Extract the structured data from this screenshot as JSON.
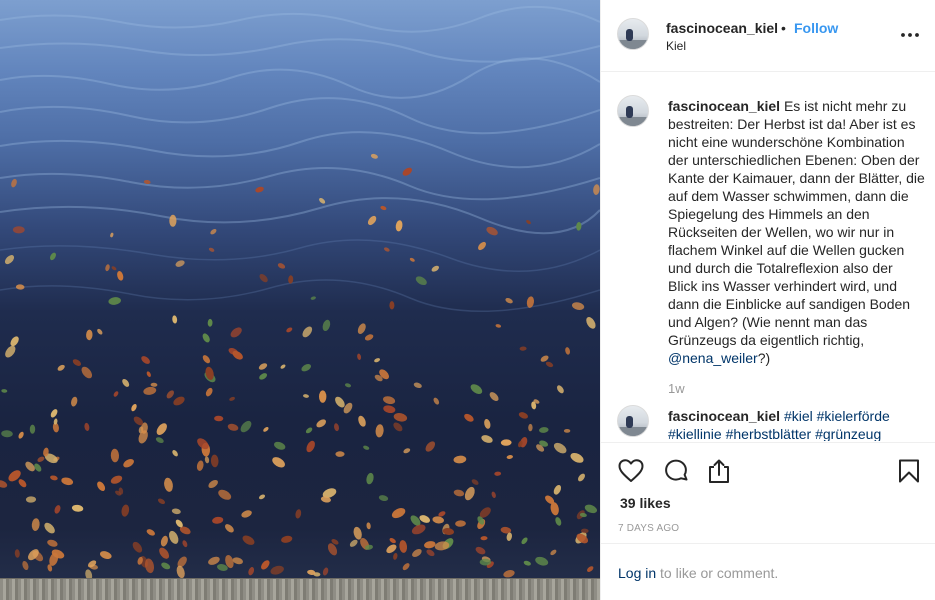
{
  "post": {
    "username": "fascinocean_kiel",
    "separator": "•",
    "follow_label": "Follow",
    "location": "Kiel",
    "caption": {
      "username": "fascinocean_kiel",
      "text": "Es ist nicht mehr zu bestreiten: Der Herbst ist da! Aber ist es nicht eine wunderschöne Kombination der unterschiedlichen Ebenen: Oben der Kante der Kaimauer, dann der Blätter, die auf dem Wasser schwimmen, dann die Spiegelung des Himmels an den Rückseiten der Wellen, wo wir nur in flachem Winkel auf die Wellen gucken und durch die Totalreflexion also der Blick ins Wasser verhindert wird, und dann die Einblicke auf sandigen Boden und Algen? (Wie nennt man das Grünzeugs da eigentlich richtig, ",
      "mention": "@nena_weiler",
      "suffix": "?)",
      "age": "1w"
    },
    "comment": {
      "username": "fascinocean_kiel",
      "hashtags": [
        "#kiel",
        "#kielerförde",
        "#kiellinie",
        "#herbstblätter",
        "#grünzeug"
      ]
    },
    "likes": "39 likes",
    "posted_ago": "7 DAYS AGO",
    "login_link": "Log in",
    "login_rest": " to like or comment."
  },
  "icons": {
    "more": "more-options-icon",
    "like": "heart-icon",
    "comment": "comment-bubble-icon",
    "share": "share-icon",
    "save": "bookmark-icon"
  },
  "colors": {
    "link_blue": "#3897f0",
    "dark_link": "#003569",
    "muted": "#999999",
    "text": "#262626"
  }
}
